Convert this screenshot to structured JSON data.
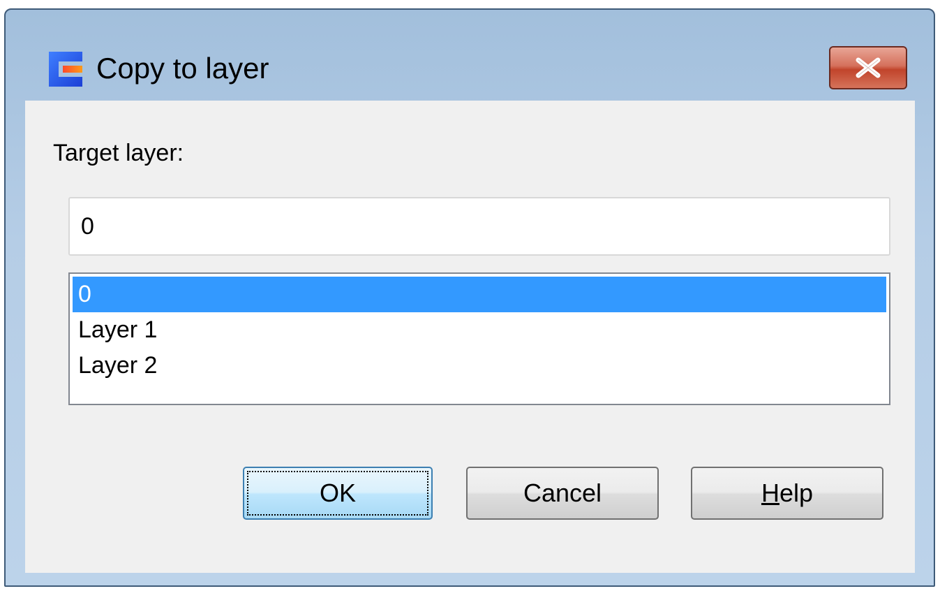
{
  "window": {
    "title": "Copy to layer",
    "close_symbol": "✕"
  },
  "dialog": {
    "target_label": "Target layer:",
    "input_value": "0",
    "layers": [
      "0",
      "Layer 1",
      "Layer 2"
    ],
    "selected_index": 0
  },
  "buttons": {
    "ok": "OK",
    "cancel": "Cancel",
    "help_accel": "H",
    "help_rest": "elp"
  },
  "icons": {
    "app": "app-logo-icon",
    "close": "close-icon"
  },
  "colors": {
    "selection": "#3399ff",
    "close_button": "#c1442b",
    "titlebar": "#a2bfdc"
  }
}
